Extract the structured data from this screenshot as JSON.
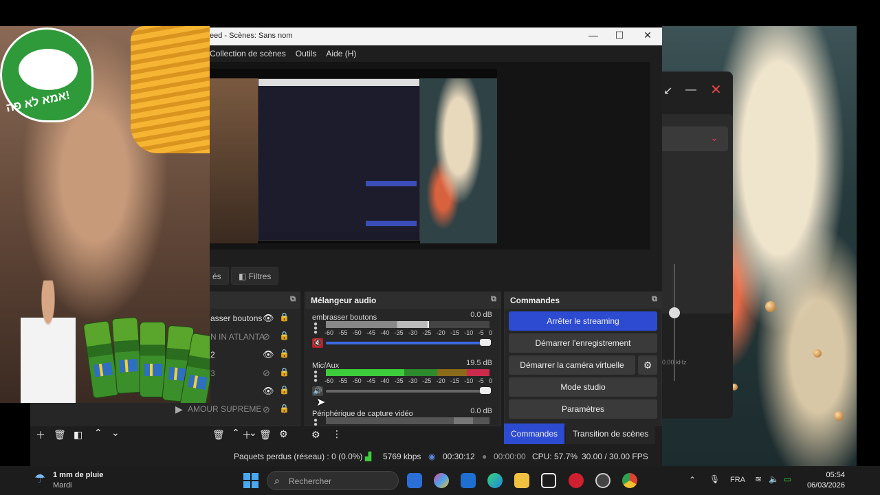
{
  "obs_window": {
    "title": "eed - Scènes: Sans nom",
    "menu": [
      "Collection de scènes",
      "Outils",
      "Aide (H)"
    ]
  },
  "source_toolbar": {
    "tabs": [
      "és",
      "Filtres"
    ]
  },
  "sources": {
    "items": [
      {
        "label": "asser boutons",
        "visible": true
      },
      {
        "label": "N IN ATLANTA",
        "visible": false
      },
      {
        "label": "2",
        "visible": true
      },
      {
        "label": "3",
        "visible": false
      },
      {
        "label": "",
        "visible": true
      },
      {
        "label": "AMOUR SUPREME",
        "visible": false
      }
    ]
  },
  "mixer": {
    "title": "Mélangeur audio",
    "scale": [
      "-60",
      "-55",
      "-50",
      "-45",
      "-40",
      "-35",
      "-30",
      "-25",
      "-20",
      "-15",
      "-10",
      "-5",
      "0"
    ],
    "tracks": [
      {
        "name": "embrasser boutons",
        "db": "0.0 dB",
        "level": 0.8,
        "volume": 1.0
      },
      {
        "name": "Mic/Aux",
        "db": "19.5 dB",
        "level": 0.95,
        "volume": 1.0
      },
      {
        "name": "Périphérique de capture vidéo",
        "db": "0.0 dB",
        "level": 0.85,
        "volume": 1.0
      }
    ]
  },
  "commands": {
    "title": "Commandes",
    "stop_streaming": "Arrêter le streaming",
    "start_recording": "Démarrer l'enregistrement",
    "start_virtual_cam": "Démarrer la caméra virtuelle",
    "studio_mode": "Mode studio",
    "settings": "Paramètres"
  },
  "dock_tabs": [
    "Commandes",
    "Transition de scènes"
  ],
  "status": {
    "dropped": "Paquets perdus (réseau) : 0 (0.0%)",
    "bitrate": "5769 kbps",
    "stream_time": "00:30:12",
    "rec_time": "00:00:00",
    "cpu": "CPU: 57.7%",
    "fps": "30.00 / 30.00 FPS"
  },
  "webcam": {
    "badge_text": "אמא לא פה!"
  },
  "bgwin": {
    "freq": "0.00 kHz"
  },
  "taskbar": {
    "weather_line1": "1 mm de pluie",
    "weather_line2": "Mardi",
    "search_placeholder": "Rechercher",
    "lang": "FRA",
    "time": "05:54",
    "date": "06/03/2026"
  },
  "colors": {
    "accent": "#2d4bd1",
    "meter_green": "#3ccc3c",
    "meter_red": "#cc2a4a"
  }
}
